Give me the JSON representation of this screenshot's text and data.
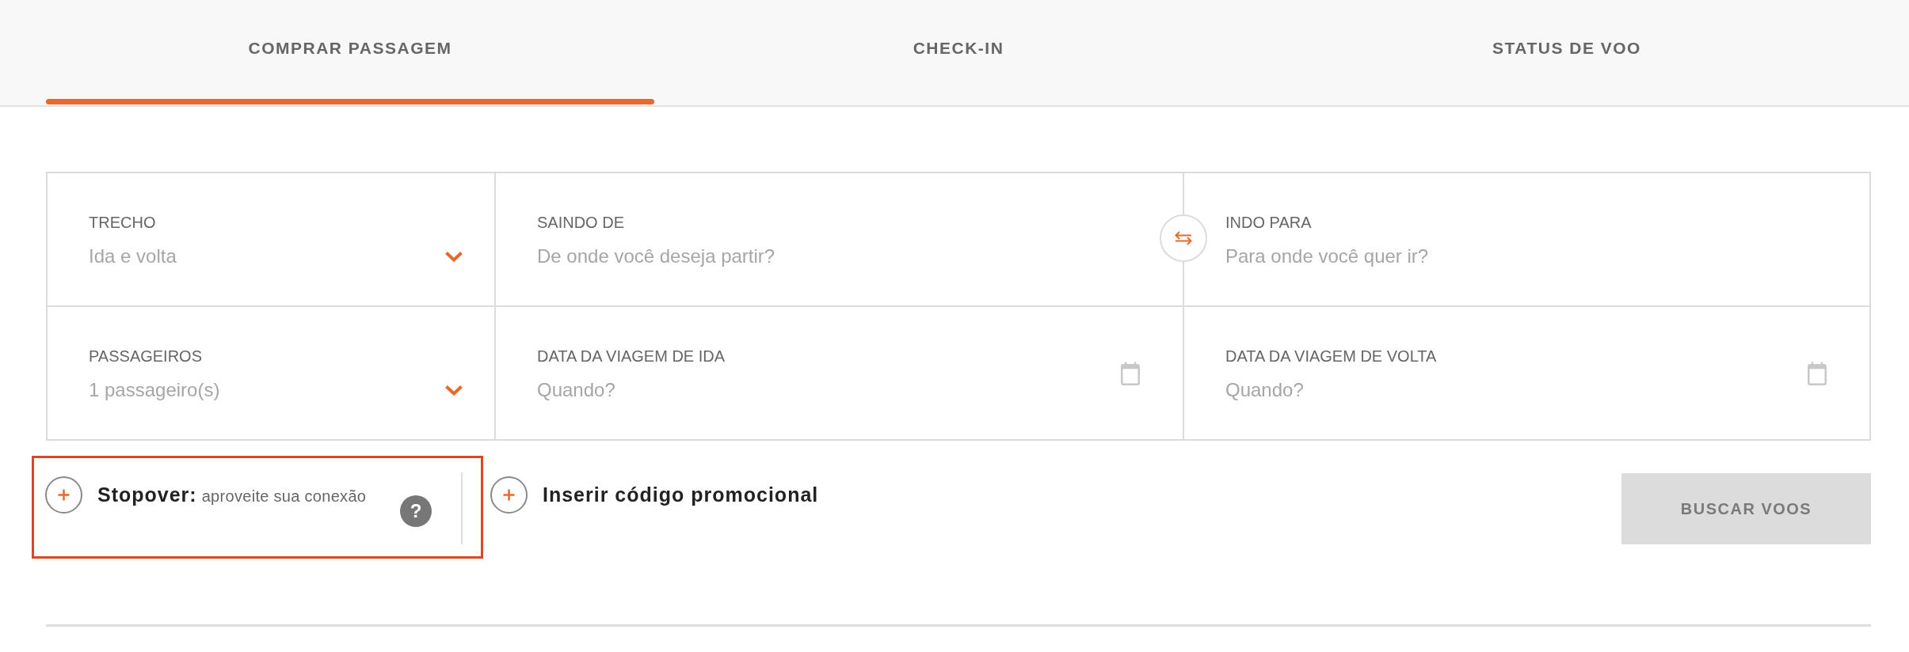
{
  "tabs": [
    {
      "label": "COMPRAR PASSAGEM",
      "selected": true
    },
    {
      "label": "CHECK-IN",
      "selected": false
    },
    {
      "label": "STATUS DE VOO",
      "selected": false
    }
  ],
  "form": {
    "fields": [
      {
        "kind": "select",
        "label": "TRECHO",
        "value": "Ida e volta"
      },
      {
        "kind": "text",
        "label": "SAINDO DE",
        "placeholder": "De onde você deseja partir?"
      },
      {
        "kind": "text",
        "label": "INDO PARA",
        "placeholder": "Para onde você quer ir?"
      },
      {
        "kind": "select",
        "label": "PASSAGEIROS",
        "value": "1 passageiro(s)"
      },
      {
        "kind": "date",
        "label": "DATA DA VIAGEM DE IDA",
        "placeholder": "Quando?"
      },
      {
        "kind": "date",
        "label": "DATA DA VIAGEM DE VOLTA",
        "placeholder": "Quando?"
      }
    ]
  },
  "options": [
    {
      "title": "Stopover:",
      "description": "aproveite sua conexão",
      "help": "?",
      "highlighted": true
    },
    {
      "title": "Inserir código promocional",
      "highlighted": false
    }
  ],
  "search_button": {
    "label": "BUSCAR VOOS",
    "disabled": true
  }
}
